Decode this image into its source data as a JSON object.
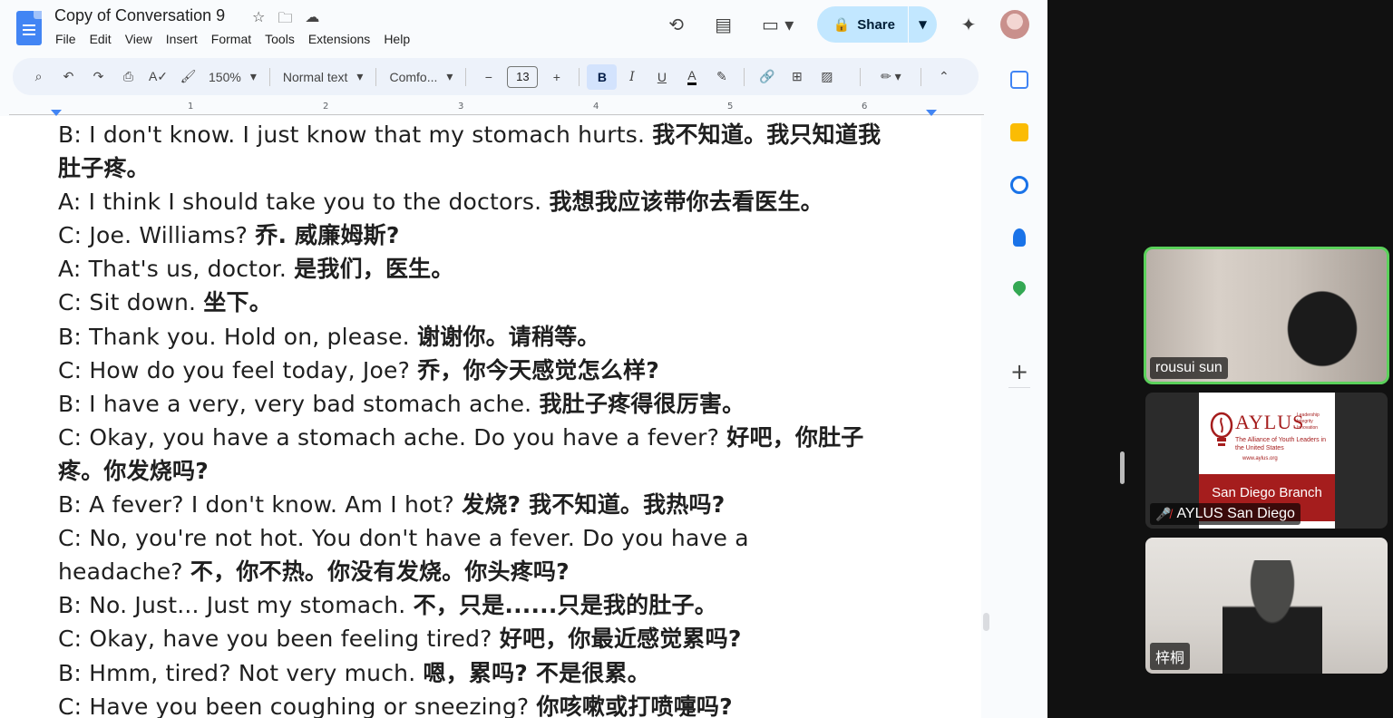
{
  "docs": {
    "title": "Copy of Conversation 9",
    "menu": [
      "File",
      "Edit",
      "View",
      "Insert",
      "Format",
      "Tools",
      "Extensions",
      "Help"
    ],
    "share_label": "Share",
    "toolbar": {
      "zoom": "150%",
      "style": "Normal text",
      "font": "Comfo...",
      "font_size": "13",
      "bold": "B",
      "italic": "I",
      "underline": "U",
      "text_color": "A"
    },
    "ruler_numbers": [
      "1",
      "2",
      "3",
      "4",
      "5",
      "6"
    ],
    "lines": [
      {
        "en": "B: I don't know. I just know that my stomach hurts. ",
        "zh": "我不知道。我只知道我"
      },
      {
        "en": "",
        "zh": "肚子疼。"
      },
      {
        "en": "A: I think I should take you to the doctors. ",
        "zh": "我想我应该带你去看医生。"
      },
      {
        "en": "C: Joe. Williams? ",
        "zh": "乔. 威廉姆斯?"
      },
      {
        "en": "A: That's us, doctor. ",
        "zh": "是我们，医生。"
      },
      {
        "en": "C: Sit down. ",
        "zh": "坐下。"
      },
      {
        "en": "B: Thank you. Hold on, please. ",
        "zh": "谢谢你。请稍等。"
      },
      {
        "en": "C: How do you feel today, Joe? ",
        "zh": "乔，你今天感觉怎么样?"
      },
      {
        "en": "B: I have a very, very bad stomach ache. ",
        "zh": "我肚子疼得很厉害。"
      },
      {
        "en": "C: Okay, you have a stomach ache. Do you have a fever? ",
        "zh": "好吧，你肚子"
      },
      {
        "en": "",
        "zh": "疼。你发烧吗?"
      },
      {
        "en": "B: A fever? I don't know. Am I hot? ",
        "zh": "发烧? 我不知道。我热吗?"
      },
      {
        "en": "C: No, you're not hot. You don't have a fever. Do you have a",
        "zh": ""
      },
      {
        "en": "headache? ",
        "zh": "不，你不热。你没有发烧。你头疼吗?"
      },
      {
        "en": "B: No. Just... Just my stomach. ",
        "zh": "不，只是......只是我的肚子。"
      },
      {
        "en": "C: Okay, have you been feeling tired? ",
        "zh": "好吧，你最近感觉累吗?"
      },
      {
        "en": "B: Hmm, tired? Not very much. ",
        "zh": "嗯，累吗? 不是很累。"
      },
      {
        "en": "C: Have you been coughing or sneezing? ",
        "zh": "你咳嗽或打喷嚏吗?"
      }
    ]
  },
  "meeting": {
    "participants": [
      {
        "name": "rousui sun",
        "active": true
      },
      {
        "name": "AYLUS San Diego",
        "muted": true
      },
      {
        "name": "梓桐"
      }
    ],
    "aylus_card": {
      "brand": "AYLUS",
      "tagline_right": "Leadership Integrity Innovation",
      "full_name": "The Alliance of Youth Leaders in the United States",
      "url": "www.aylus.org",
      "branch": "San Diego Branch"
    }
  },
  "colors": {
    "docs_blue": "#4285f4",
    "share_bg": "#c2e7ff",
    "active_speaker": "#5bd15b",
    "aylus_red": "#a51d1d"
  }
}
